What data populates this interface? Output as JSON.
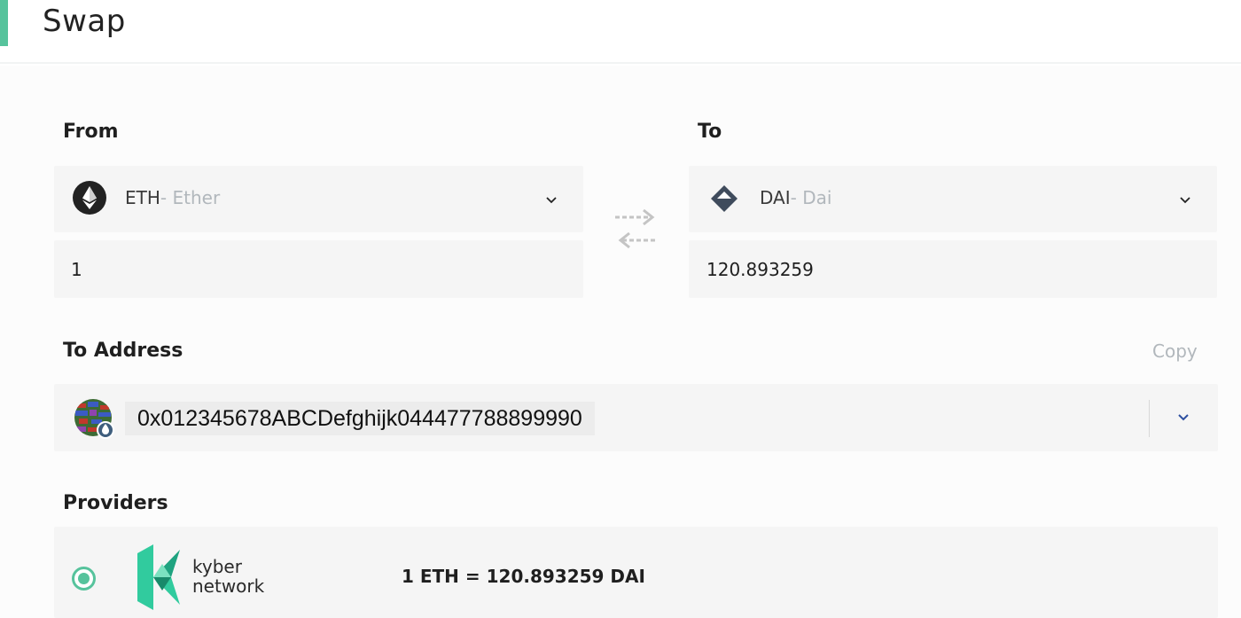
{
  "header": {
    "title": "Swap"
  },
  "from": {
    "label": "From",
    "token": {
      "symbol": "ETH",
      "name": "- Ether",
      "icon": "ether-icon"
    },
    "amount": "1"
  },
  "to": {
    "label": "To",
    "token": {
      "symbol": "DAI",
      "name": "- Dai",
      "icon": "dai-icon"
    },
    "amount": "120.893259"
  },
  "address": {
    "label": "To Address",
    "copy_label": "Copy",
    "value": "0x012345678ABCDefghijk044477788899990"
  },
  "providers": {
    "label": "Providers",
    "items": [
      {
        "brand_line1": "kyber",
        "brand_line2": "network",
        "rate": "1 ETH = 120.893259 DAI",
        "selected": true
      }
    ]
  },
  "colors": {
    "accent": "#56c39c",
    "muted_text": "#b1b7bc",
    "field_bg": "#f5f5f5",
    "dropdown_chevron": "#2d4fa0"
  }
}
